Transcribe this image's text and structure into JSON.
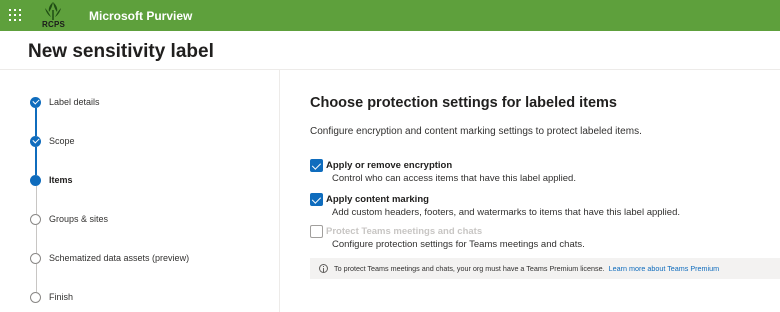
{
  "topbar": {
    "app_title": "Microsoft Purview",
    "logo_text": "RCPS",
    "color": "#5ea03c"
  },
  "page": {
    "title": "New sensitivity label"
  },
  "stepper": {
    "steps": [
      {
        "label": "Label details",
        "state": "done"
      },
      {
        "label": "Scope",
        "state": "done"
      },
      {
        "label": "Items",
        "state": "current"
      },
      {
        "label": "Groups & sites",
        "state": "todo"
      },
      {
        "label": "Schematized data assets (preview)",
        "state": "todo"
      },
      {
        "label": "Finish",
        "state": "todo"
      }
    ]
  },
  "main": {
    "heading": "Choose protection settings for labeled items",
    "description": "Configure encryption and content marking settings to protect labeled items.",
    "options": [
      {
        "label": "Apply or remove encryption",
        "description": "Control who can access items that have this label applied.",
        "checked": true,
        "disabled": false
      },
      {
        "label": "Apply content marking",
        "description": "Add custom headers, footers, and watermarks to items that have this label applied.",
        "checked": true,
        "disabled": false
      },
      {
        "label": "Protect Teams meetings and chats",
        "description": "Configure protection settings for Teams meetings and chats.",
        "checked": false,
        "disabled": true
      }
    ],
    "info": {
      "text": "To protect Teams meetings and chats, your org must have a Teams Premium license.",
      "link": "Learn more about Teams Premium"
    }
  },
  "colors": {
    "accent": "#0f6cbd",
    "topbar": "#5ea03c"
  }
}
